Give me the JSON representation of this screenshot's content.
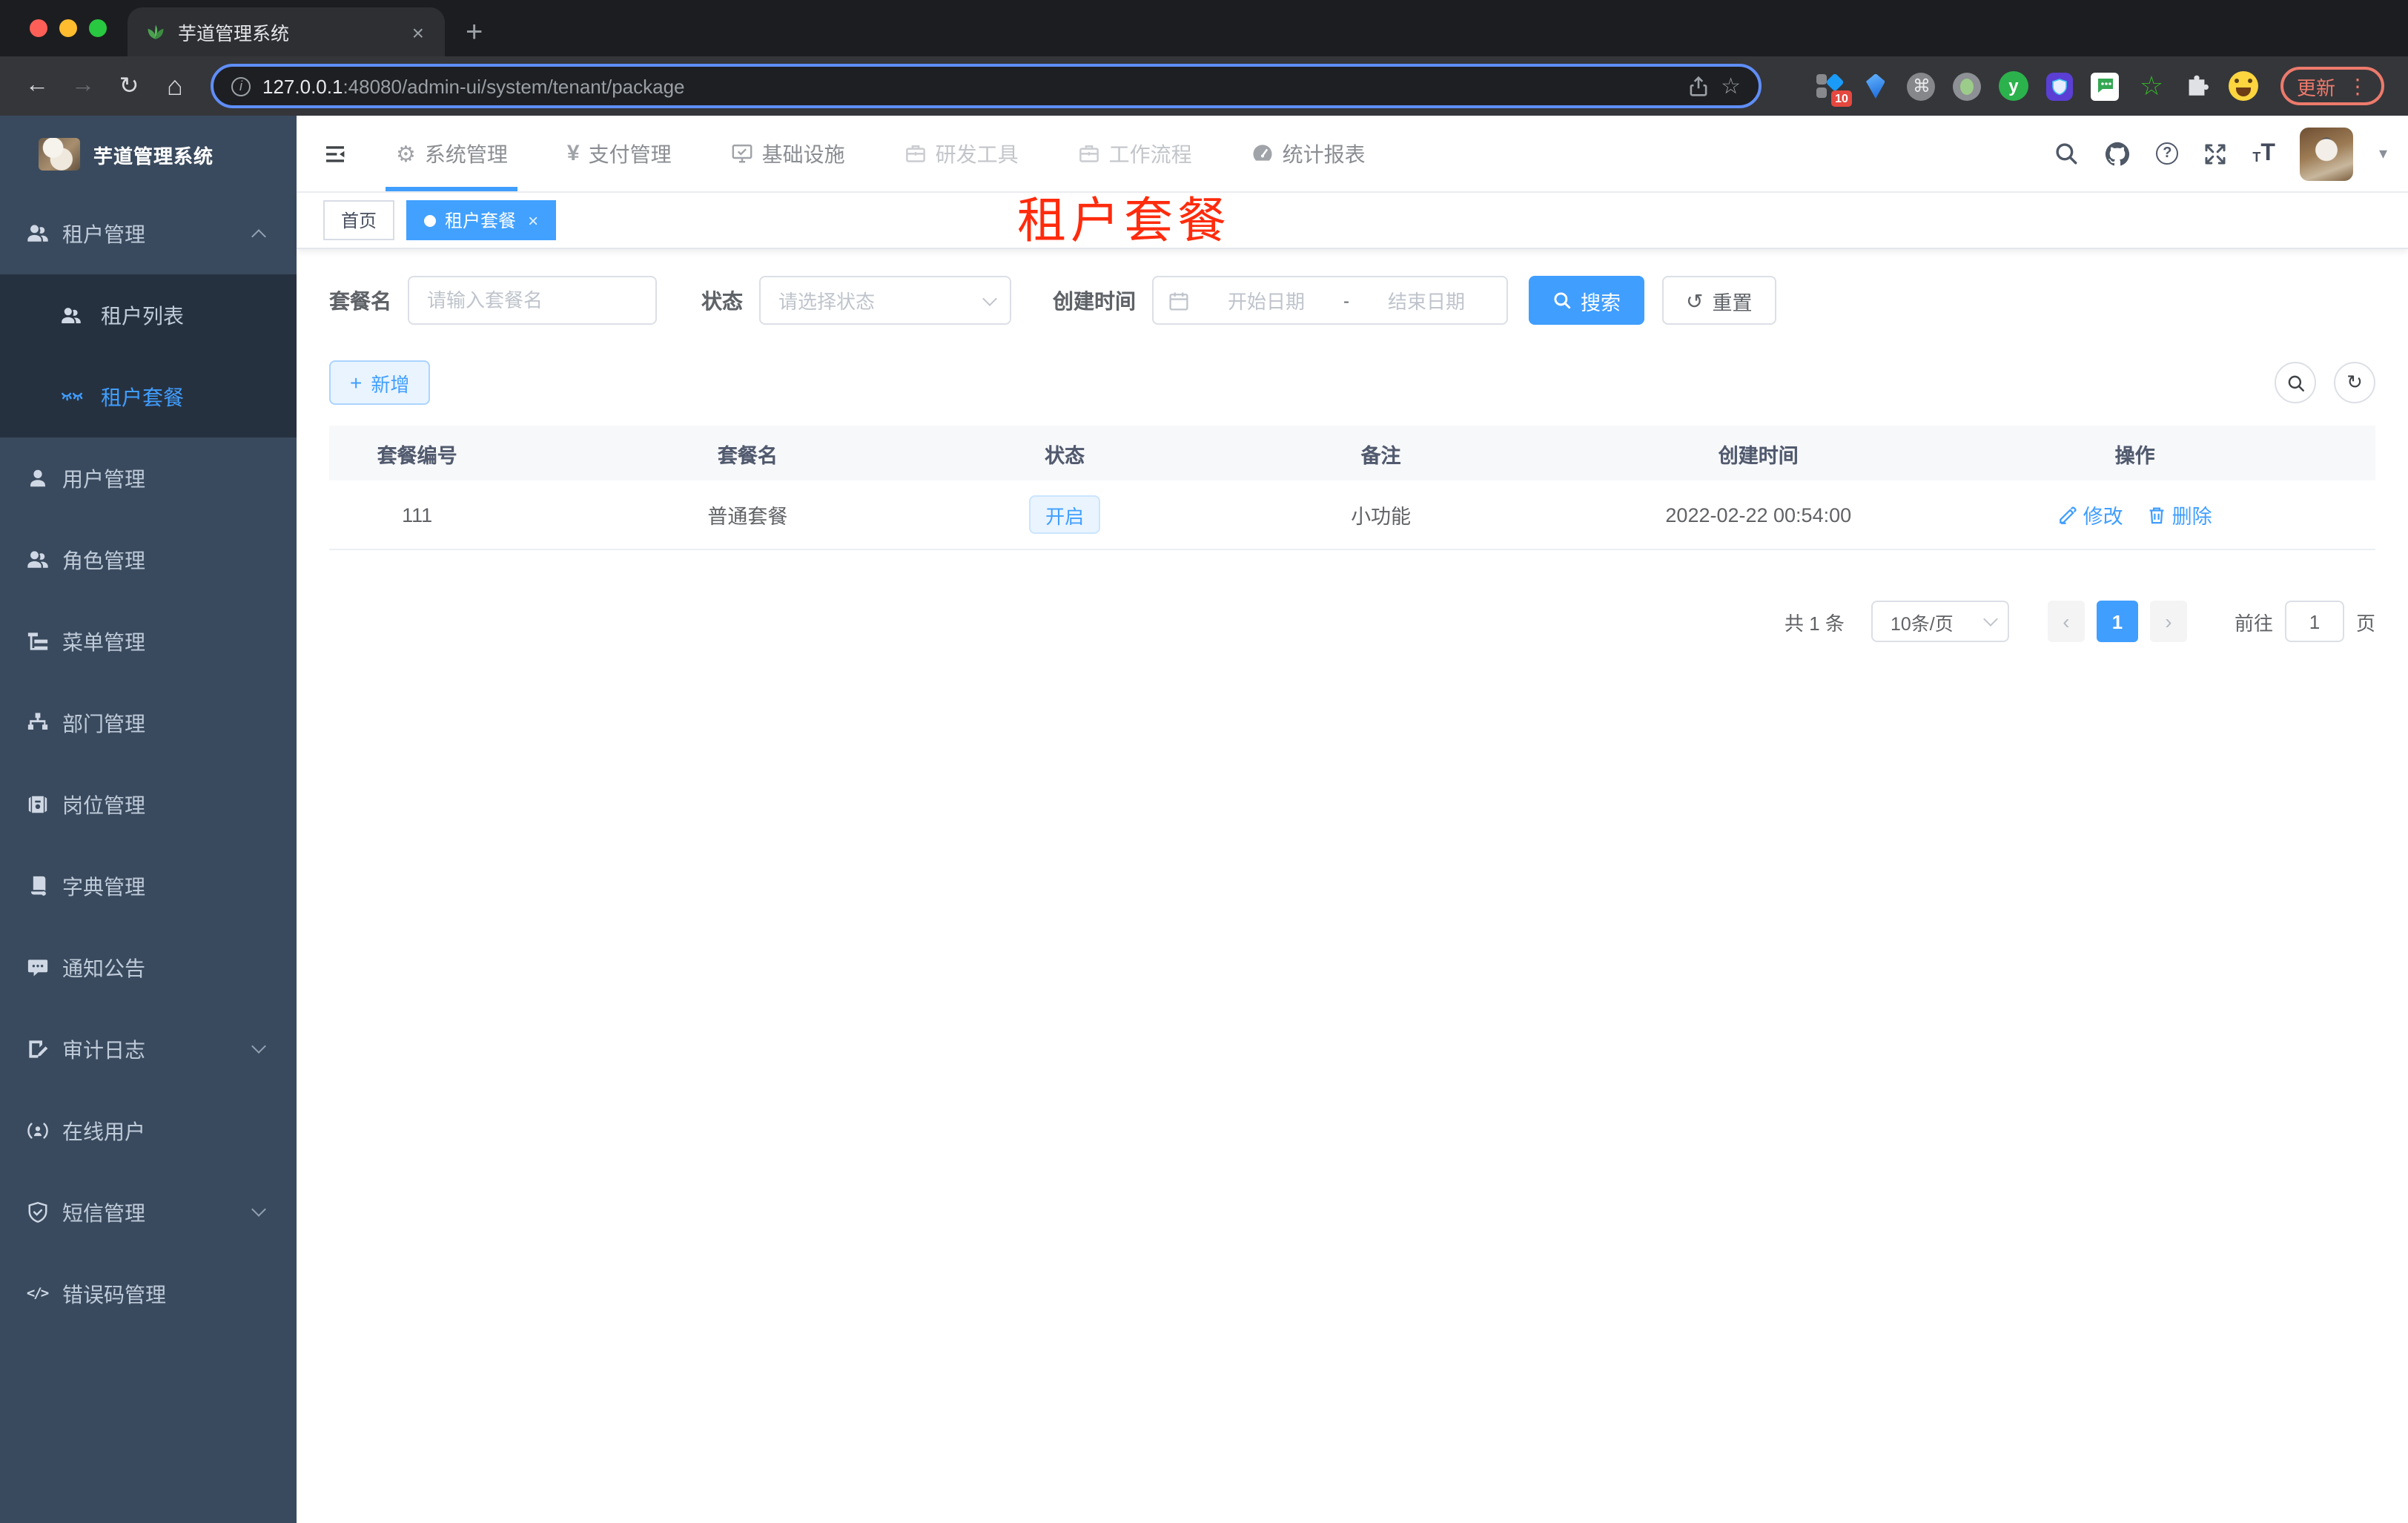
{
  "colors": {
    "primary": "#409eff",
    "sidebar_bg": "#3a4a5e",
    "sidebar_submenu_bg": "#263140",
    "sidebar_text": "#bfcbd9",
    "watermark_red": "#ff2b0d",
    "chrome_dark": "#35363a",
    "update_pill": "#ed7a6c",
    "table_header_bg": "#f7f8fa"
  },
  "browser": {
    "tab_title": "芋道管理系统",
    "tab_close": "×",
    "new_tab": "+",
    "back_glyph": "←",
    "forward_glyph": "→",
    "reload_glyph": "↻",
    "home_glyph": "⌂",
    "info_glyph": "i",
    "url_host": "127.0.0.1",
    "url_rest": ":48080/admin-ui/system/tenant/package",
    "bookmark_star": "☆",
    "ext_badge": "10",
    "cmd_glyph": "⌘",
    "y_glyph": "y",
    "green_star_glyph": "☆",
    "update_label": "更新",
    "menu_dots": "⋮"
  },
  "header": {
    "nav": [
      {
        "label": "系统管理"
      },
      {
        "label": "支付管理"
      },
      {
        "label": "基础设施"
      },
      {
        "label": "研发工具"
      },
      {
        "label": "工作流程"
      },
      {
        "label": "统计报表"
      }
    ],
    "gear_glyph": "⚙",
    "yen_glyph": "¥",
    "help_glyph": "?",
    "font_icon_small": "T",
    "font_icon_large": "T",
    "caret_glyph": "▾"
  },
  "sidebar": {
    "logo_title": "芋道管理系统",
    "group": {
      "label": "租户管理",
      "children": [
        {
          "label": "租户列表"
        },
        {
          "label": "租户套餐"
        }
      ]
    },
    "items": [
      {
        "label": "用户管理"
      },
      {
        "label": "角色管理"
      },
      {
        "label": "菜单管理"
      },
      {
        "label": "部门管理"
      },
      {
        "label": "岗位管理"
      },
      {
        "label": "字典管理"
      },
      {
        "label": "通知公告"
      },
      {
        "label": "审计日志"
      },
      {
        "label": "在线用户"
      },
      {
        "label": "短信管理"
      },
      {
        "label": "错误码管理"
      }
    ],
    "code_glyph": "</>"
  },
  "tags": {
    "home": "首页",
    "current": "租户套餐",
    "close": "×"
  },
  "watermark": "租户套餐",
  "filters": {
    "name_label": "套餐名",
    "name_placeholder": "请输入套餐名",
    "status_label": "状态",
    "status_placeholder": "请选择状态",
    "time_label": "创建时间",
    "start_placeholder": "开始日期",
    "separator": "-",
    "end_placeholder": "结束日期",
    "search_label": "搜索",
    "reset_label": "重置",
    "reset_glyph": "↺"
  },
  "toolbar": {
    "add_label": "新增",
    "plus_glyph": "+",
    "refresh_glyph": "↻"
  },
  "table": {
    "columns": [
      "套餐编号",
      "套餐名",
      "状态",
      "备注",
      "创建时间",
      "操作"
    ],
    "rows": [
      {
        "id": "111",
        "name": "普通套餐",
        "status": "开启",
        "remark": "小功能",
        "created": "2022-02-22 00:54:00",
        "edit": "修改",
        "delete": "删除"
      }
    ]
  },
  "pagination": {
    "total": "共 1 条",
    "page_size": "10条/页",
    "prev": "‹",
    "page": "1",
    "next": "›",
    "goto_label": "前往",
    "goto_value": "1",
    "unit_label": "页"
  }
}
